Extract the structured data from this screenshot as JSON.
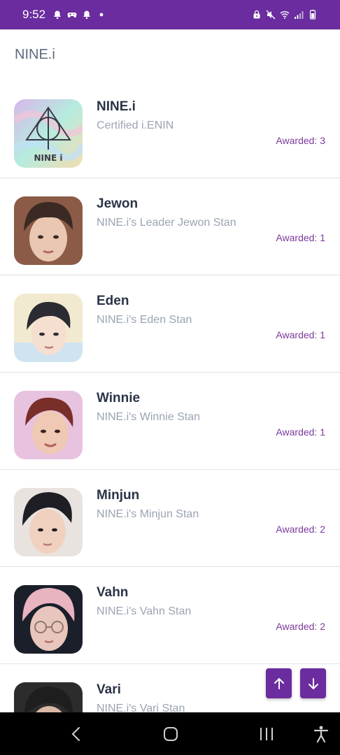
{
  "status_bar": {
    "time": "9:52",
    "left_icons": [
      "bell-icon",
      "game-controller-icon",
      "bell-icon",
      "dot-icon"
    ],
    "right_icons": [
      "lock-icon",
      "mute-icon",
      "wifi-icon",
      "signal-icon",
      "battery-icon"
    ],
    "color": "#6a2c9e"
  },
  "header": {
    "title": "NINE.i"
  },
  "items": [
    {
      "name": "NINE.i",
      "subtitle": "Certified i.ENIN",
      "awarded": "Awarded: 3",
      "avatar_colors": [
        "#d7b6ea",
        "#b6ecde",
        "#f3ddb1"
      ],
      "avatar_caption": "NINE i"
    },
    {
      "name": "Jewon",
      "subtitle": "NINE.i's Leader Jewon Stan",
      "awarded": "Awarded: 1",
      "avatar_colors": [
        "#8c5b47",
        "#e9c7b0",
        "#3b2a24"
      ]
    },
    {
      "name": "Eden",
      "subtitle": "NINE.i's Eden Stan",
      "awarded": "Awarded: 1",
      "avatar_colors": [
        "#f2ead0",
        "#f5dfd1",
        "#2b2b33"
      ]
    },
    {
      "name": "Winnie",
      "subtitle": "NINE.i's Winnie Stan",
      "awarded": "Awarded: 1",
      "avatar_colors": [
        "#e7c3df",
        "#efc9b3",
        "#7a2e2a"
      ]
    },
    {
      "name": "Minjun",
      "subtitle": "NINE.i's Minjun Stan",
      "awarded": "Awarded: 2",
      "avatar_colors": [
        "#e9e3e0",
        "#f0d1c0",
        "#1f1e24"
      ]
    },
    {
      "name": "Vahn",
      "subtitle": "NINE.i's Vahn Stan",
      "awarded": "Awarded: 2",
      "avatar_colors": [
        "#1a1f2a",
        "#e8c6bd",
        "#e7b4bf"
      ]
    },
    {
      "name": "Vari",
      "subtitle": "NINE.i's Vari Stan",
      "awarded": "",
      "avatar_colors": [
        "#2c2c2c",
        "#d9b8a8",
        "#1e1e1e"
      ]
    }
  ],
  "scroll_buttons": {
    "up_icon": "arrow-up-icon",
    "down_icon": "arrow-down-icon",
    "color": "#6a2c9e"
  },
  "nav_bar": {
    "icons": [
      "back-icon",
      "home-icon",
      "recents-icon",
      "accessibility-icon"
    ]
  }
}
